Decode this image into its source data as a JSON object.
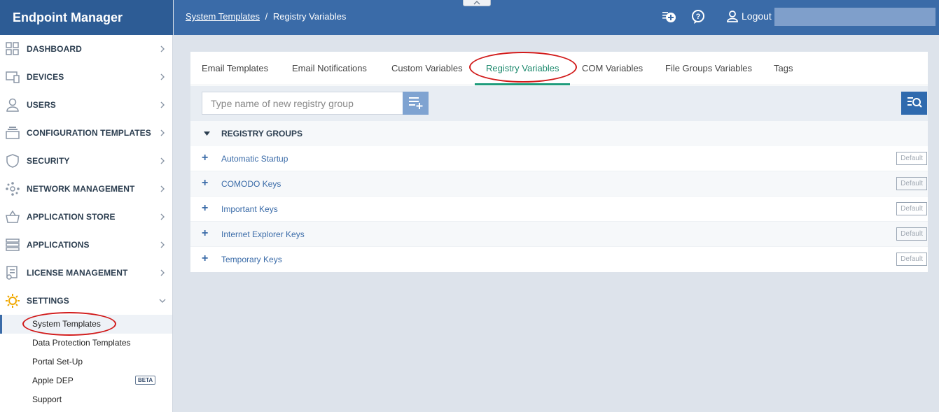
{
  "app": {
    "title": "Endpoint Manager"
  },
  "breadcrumb": {
    "parent": "System Templates",
    "separator": "/",
    "current": "Registry Variables"
  },
  "header": {
    "logout_label": "Logout"
  },
  "sidebar": {
    "items": [
      {
        "label": "DASHBOARD",
        "icon": "grid-icon"
      },
      {
        "label": "DEVICES",
        "icon": "devices-icon"
      },
      {
        "label": "USERS",
        "icon": "user-icon"
      },
      {
        "label": "CONFIGURATION TEMPLATES",
        "icon": "templates-icon"
      },
      {
        "label": "SECURITY",
        "icon": "shield-icon"
      },
      {
        "label": "NETWORK MANAGEMENT",
        "icon": "network-icon"
      },
      {
        "label": "APPLICATION STORE",
        "icon": "basket-icon"
      },
      {
        "label": "APPLICATIONS",
        "icon": "server-icon"
      },
      {
        "label": "LICENSE MANAGEMENT",
        "icon": "certificate-icon"
      },
      {
        "label": "SETTINGS",
        "icon": "gear-icon"
      }
    ],
    "settings_sub": [
      {
        "label": "System Templates",
        "active": true
      },
      {
        "label": "Data Protection Templates"
      },
      {
        "label": "Portal Set-Up"
      },
      {
        "label": "Apple DEP",
        "badge": "BETA"
      },
      {
        "label": "Support"
      }
    ]
  },
  "tabs": [
    {
      "label": "Email Templates"
    },
    {
      "label": "Email Notifications"
    },
    {
      "label": "Custom Variables"
    },
    {
      "label": "Registry Variables",
      "active": true
    },
    {
      "label": "COM Variables"
    },
    {
      "label": "File Groups Variables"
    },
    {
      "label": "Tags"
    }
  ],
  "toolbar": {
    "input_placeholder": "Type name of new registry group",
    "input_value": ""
  },
  "groups": {
    "title": "REGISTRY GROUPS",
    "rows": [
      {
        "name": "Automatic Startup",
        "badge": "Default"
      },
      {
        "name": "COMODO Keys",
        "badge": "Default"
      },
      {
        "name": "Important Keys",
        "badge": "Default"
      },
      {
        "name": "Internet Explorer Keys",
        "badge": "Default"
      },
      {
        "name": "Temporary Keys",
        "badge": "Default"
      }
    ]
  },
  "colors": {
    "header": "#3a6ba8",
    "brand": "#2d5c95",
    "active_tab": "#1e8a6e",
    "annotation": "#d11a1a"
  }
}
